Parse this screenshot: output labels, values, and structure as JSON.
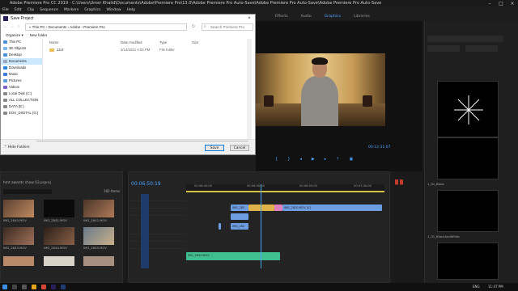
{
  "app": {
    "title": "Adobe Premiere Pro CC 2019 - C:\\Users\\Umer Khalid\\Documents\\Adobe\\Premiere Pro\\13.0\\Adobe Premiere Pro Auto-Save\\Adobe Premiere Pro Auto-Save\\Adobe Premiere Pro Auto-Save",
    "icon_text": "Pr",
    "menu": [
      "File",
      "Edit",
      "Clip",
      "Sequence",
      "Markers",
      "Graphics",
      "Window",
      "Help"
    ],
    "workspaces": [
      "Effects",
      "Audio",
      "Graphics",
      "Libraries"
    ],
    "active_workspace": "Graphics"
  },
  "dialog": {
    "title": "Save Project",
    "breadcrumb": "« This PC › Documents › Adobe › Premiere Pro",
    "search_placeholder": "Search Premiere Pro",
    "organize": "Organize ▾",
    "new_folder": "New folder",
    "columns": {
      "name": "Name",
      "date": "Date modified",
      "type": "Type",
      "size": "Size"
    },
    "files": [
      {
        "name": "13.0",
        "date": "3/14/2021 4:03 PM",
        "type": "File folder"
      }
    ],
    "sidebar": [
      "This PC",
      "3D Objects",
      "Desktop",
      "Documents",
      "Downloads",
      "Music",
      "Pictures",
      "Videos",
      "Local Disk (C:)",
      "ALL COLLECTION",
      "DATA (E:)",
      "EOS_DIGITAL (G:)"
    ],
    "selected_sidebar": "Documents",
    "file_name_label": "File name:",
    "file_name_value": "hmt awards show 03.prproj",
    "save_type_label": "Save as type:",
    "save_type_value": "Adobe Premiere Pro Project (*.prproj)",
    "hide_folders": "Hide Folders",
    "save": "Save",
    "cancel": "Cancel"
  },
  "program": {
    "timecode": "00:12:31:07"
  },
  "project": {
    "file_label": "hmt awards show 03.prproj",
    "count": "182 Items",
    "thumbs": [
      {
        "caption": "IMG_2840.MOV"
      },
      {
        "caption": "IMG_2841.MOV"
      },
      {
        "caption": "IMG_2842.MOV"
      },
      {
        "caption": "IMG_2843.MOV"
      },
      {
        "caption": "IMG_2844.MOV"
      },
      {
        "caption": "IMG_2845.MOV"
      }
    ]
  },
  "timeline": {
    "current_time": "00:06:50:19",
    "ruler_marks": [
      "00:06:45:00",
      "00:06:50:00",
      "00:06:55:00",
      "00:07:00:00"
    ],
    "tracks": [
      "V3",
      "V2",
      "V1",
      "A1",
      "A2",
      "A3"
    ],
    "clips": [
      {
        "label": "IMG_282",
        "track": "V2",
        "color": "#6b9de0"
      },
      {
        "label": "IMG_2820.MOV [V]",
        "track": "V1",
        "color": "#6b9de0"
      },
      {
        "label": "IMG_282",
        "track": "A1",
        "color": "#6b9de0"
      },
      {
        "label": "IMG_2820.MOV",
        "track": "A2",
        "color": "#3fbf8f"
      }
    ]
  },
  "right_panel": {
    "items": [
      {
        "caption": "1_01_Basic"
      },
      {
        "caption": "1_01_BlackAndWhite"
      }
    ]
  },
  "taskbar": {
    "time": "11:47 PM",
    "lang": "ENG"
  }
}
